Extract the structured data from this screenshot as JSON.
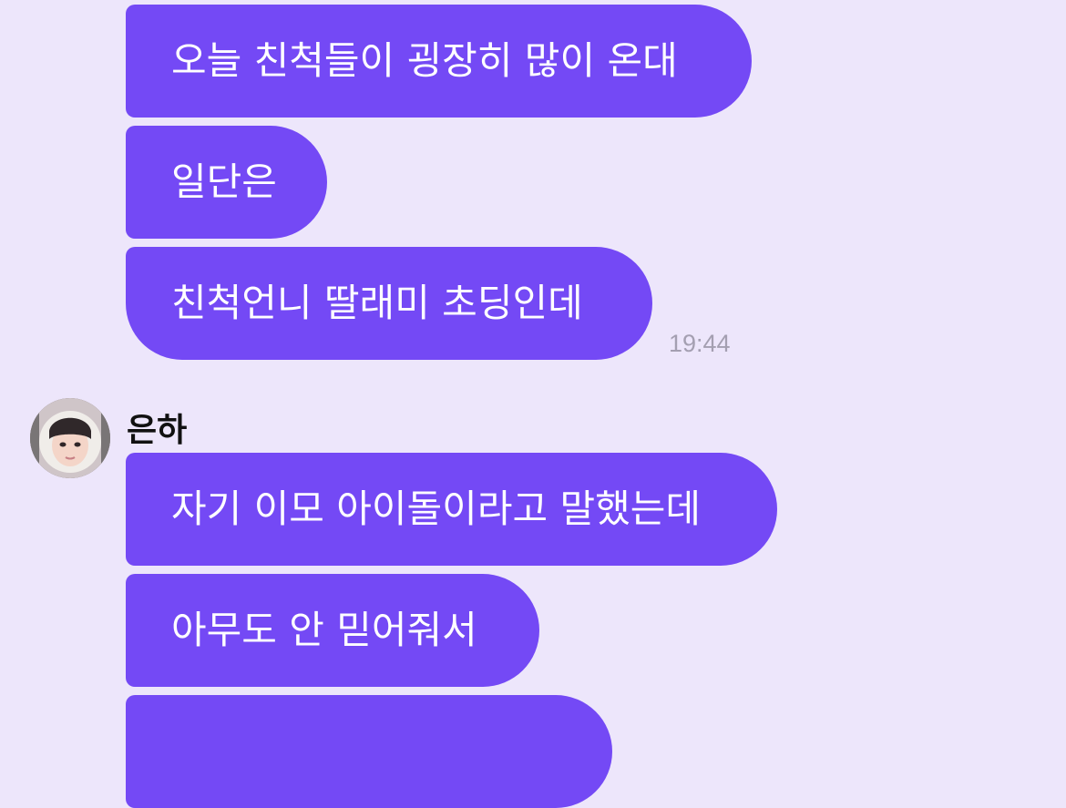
{
  "colors": {
    "background": "#ede6fb",
    "bubble": "#7449f5",
    "bubble_text": "#ffffff",
    "time_text": "#a49fb1"
  },
  "messages_group_1": {
    "items": [
      {
        "text": "오늘 친척들이 굉장히 많이 온대"
      },
      {
        "text": "일단은"
      },
      {
        "text": "친척언니 딸래미 초딩인데"
      }
    ],
    "time": "19:44"
  },
  "sender": {
    "name": "은하",
    "avatar_icon": "profile-photo-icon"
  },
  "messages_group_2": {
    "items": [
      {
        "text": "자기 이모 아이돌이라고 말했는데"
      },
      {
        "text": "아무도 안 믿어줘서"
      },
      {
        "text": ""
      }
    ]
  }
}
